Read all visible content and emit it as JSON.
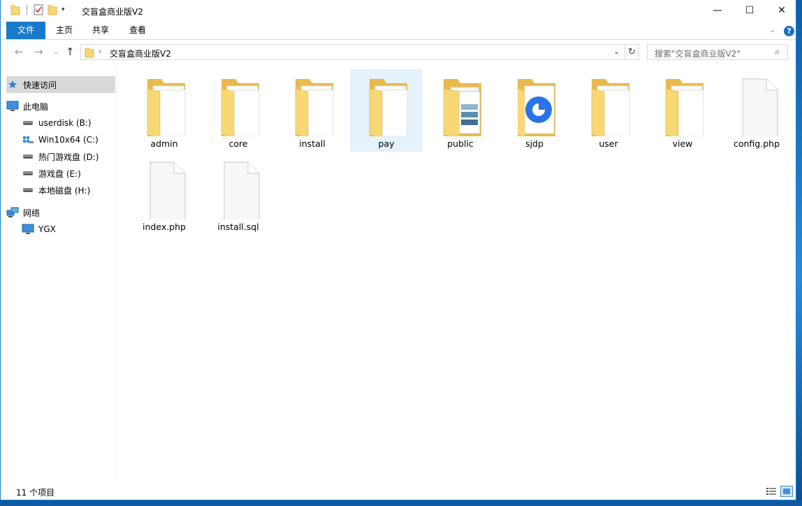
{
  "window": {
    "title": "交盲盒商业版V2",
    "controls": {
      "minimize": "—",
      "maximize": "☐",
      "close": "✕"
    }
  },
  "ribbon": {
    "tabs": [
      "文件",
      "主页",
      "共享",
      "查看"
    ],
    "help": "?"
  },
  "address": {
    "path": "交盲盒商业版V2",
    "search_placeholder": "搜索\"交盲盒商业版V2\""
  },
  "sidebar": {
    "items": [
      {
        "label": "快速访问",
        "icon": "star-icon"
      },
      {
        "label": "此电脑",
        "icon": "computer-icon"
      },
      {
        "label": "userdisk (B:)",
        "icon": "drive-icon"
      },
      {
        "label": "Win10x64 (C:)",
        "icon": "windows-drive-icon"
      },
      {
        "label": "热门游戏盘 (D:)",
        "icon": "drive-icon"
      },
      {
        "label": "游戏盘 (E:)",
        "icon": "drive-icon"
      },
      {
        "label": "本地磁盘 (H:)",
        "icon": "drive-icon"
      },
      {
        "label": "网络",
        "icon": "network-icon"
      },
      {
        "label": "YGX",
        "icon": "computer-icon"
      }
    ]
  },
  "files": [
    {
      "name": "admin",
      "type": "folder"
    },
    {
      "name": "core",
      "type": "folder"
    },
    {
      "name": "install",
      "type": "folder"
    },
    {
      "name": "pay",
      "type": "folder",
      "selected": true
    },
    {
      "name": "public",
      "type": "folder-images"
    },
    {
      "name": "sjdp",
      "type": "folder-app"
    },
    {
      "name": "user",
      "type": "folder"
    },
    {
      "name": "view",
      "type": "folder"
    },
    {
      "name": "config.php",
      "type": "file"
    },
    {
      "name": "index.php",
      "type": "file"
    },
    {
      "name": "install.sql",
      "type": "file"
    }
  ],
  "status": {
    "count": "11 个项目"
  },
  "colors": {
    "accent": "#1979ca",
    "folder": "#f8d775",
    "selection": "#e5f1fb"
  }
}
